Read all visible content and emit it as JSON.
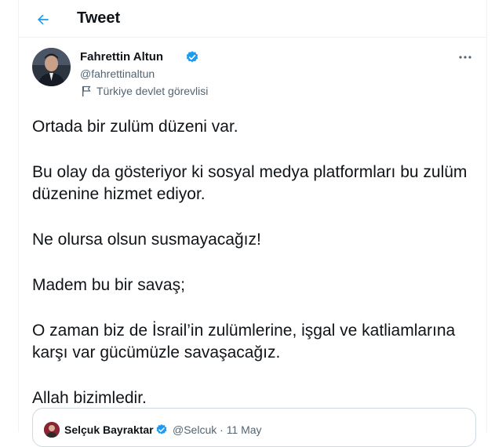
{
  "header": {
    "title": "Tweet",
    "back_icon": "arrow-left-icon"
  },
  "author": {
    "name": "Fahrettin Altun",
    "handle": "@fahrettinaltun",
    "verified": true,
    "label": "Türkiye devlet görevlisi",
    "label_icon": "flag-icon"
  },
  "tweet": {
    "paragraphs": [
      "Ortada bir zulüm düzeni var.",
      "Bu olay da gösteriyor ki sosyal medya platformları bu zulüm düzenine hizmet ediyor.",
      "Ne olursa olsun susmayacağız!",
      "Madem bu bir savaş;",
      "O zaman biz de İsrail’in zulümlerine, işgal ve katliamlarına karşı var gücümüzle savaşacağız.",
      "Allah bizimledir."
    ]
  },
  "quoted": {
    "name": "Selçuk Bayraktar",
    "handle": "@Selcuk",
    "separator": "·",
    "date": "11 May",
    "verified": true
  },
  "colors": {
    "accent": "#1d9bf0",
    "text": "#0f1419",
    "muted": "#536471",
    "border": "#eff3f4"
  }
}
